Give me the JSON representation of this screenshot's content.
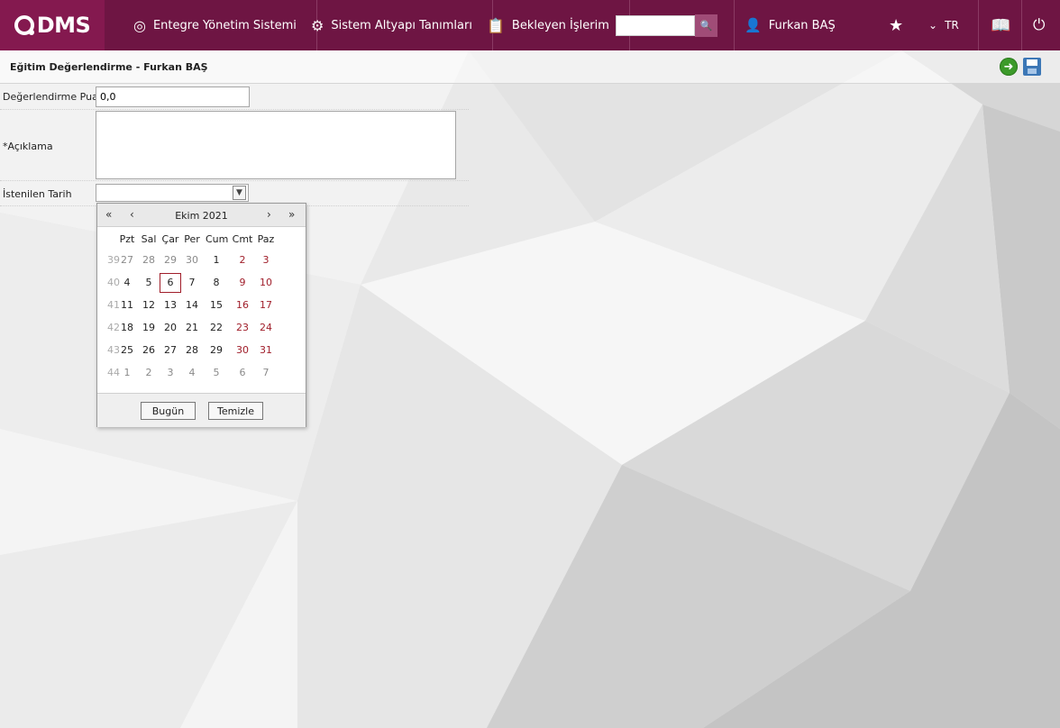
{
  "topbar": {
    "logo": "DMS",
    "nav": [
      {
        "label": "Entegre Yönetim Sistemi",
        "icon": "qdms-circle-icon"
      },
      {
        "label": "Sistem Altyapı Tanımları",
        "icon": "gear-icon"
      },
      {
        "label": "Bekleyen İşlerim",
        "icon": "clipboard-icon"
      }
    ],
    "search_value": "",
    "user_name": "Furkan BAŞ",
    "language": "TR"
  },
  "page": {
    "title": "Eğitim Değerlendirme - Furkan BAŞ"
  },
  "form": {
    "score_label": "Değerlendirme Puanı",
    "score_value": "0,0",
    "description_label": "*Açıklama",
    "description_value": "",
    "date_label": "İstenilen Tarih",
    "date_value": ""
  },
  "calendar": {
    "nav_first": "«",
    "nav_prev": "‹",
    "nav_next": "›",
    "nav_last": "»",
    "title": "Ekim 2021",
    "weekdays": [
      "Pzt",
      "Sal",
      "Çar",
      "Per",
      "Cum",
      "Cmt",
      "Paz"
    ],
    "weeks": [
      {
        "no": "39",
        "days": [
          "27",
          "28",
          "29",
          "30",
          "1",
          "2",
          "3"
        ]
      },
      {
        "no": "40",
        "days": [
          "4",
          "5",
          "6",
          "7",
          "8",
          "9",
          "10"
        ]
      },
      {
        "no": "41",
        "days": [
          "11",
          "12",
          "13",
          "14",
          "15",
          "16",
          "17"
        ]
      },
      {
        "no": "42",
        "days": [
          "18",
          "19",
          "20",
          "21",
          "22",
          "23",
          "24"
        ]
      },
      {
        "no": "43",
        "days": [
          "25",
          "26",
          "27",
          "28",
          "29",
          "30",
          "31"
        ]
      },
      {
        "no": "44",
        "days": [
          "1",
          "2",
          "3",
          "4",
          "5",
          "6",
          "7"
        ]
      }
    ],
    "today_label": "Bugün",
    "clear_label": "Temizle",
    "selected_day": "6"
  },
  "colors": {
    "topbar": "#6e1543",
    "logo_bg": "#84194f",
    "weekend": "#a01e2a"
  }
}
